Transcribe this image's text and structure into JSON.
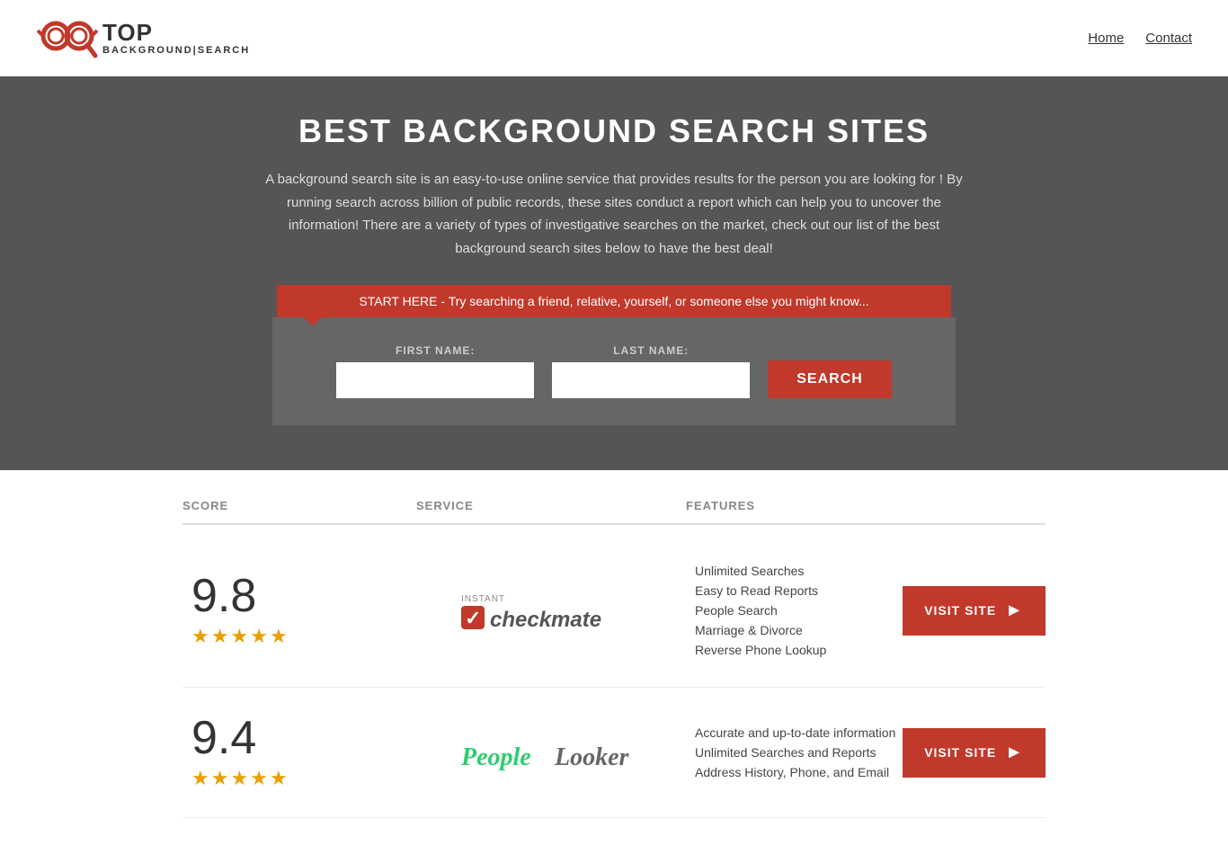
{
  "header": {
    "logo_top": "TOP",
    "logo_sub_line1": "BACKGROUND",
    "logo_sub_line2": "SEARCH",
    "nav": [
      {
        "label": "Home",
        "href": "#"
      },
      {
        "label": "Contact",
        "href": "#"
      }
    ]
  },
  "hero": {
    "title": "BEST BACKGROUND SEARCH SITES",
    "description": "A background search site is an easy-to-use online service that provides results  for the person you are looking for ! By  running  search across billion of public records, these sites conduct  a report which can help you to uncover the information! There are a variety of types of investigative searches on the market, check out our  list of the best background search sites below to have the best deal!",
    "callout": "START HERE - Try searching a friend, relative, yourself, or someone else you might know...",
    "form": {
      "first_name_label": "FIRST NAME:",
      "last_name_label": "LAST NAME:",
      "first_name_placeholder": "",
      "last_name_placeholder": "",
      "search_button": "SEARCH"
    }
  },
  "table": {
    "headers": {
      "score": "SCORE",
      "service": "SERVICE",
      "features": "FEATURES"
    },
    "rows": [
      {
        "score": "9.8",
        "stars": 4.5,
        "service_name": "Instant Checkmate",
        "service_type": "checkmate",
        "features": [
          "Unlimited Searches",
          "Easy to Read Reports",
          "People Search",
          "Marriage & Divorce",
          "Reverse Phone Lookup"
        ],
        "visit_label": "VISIT SITE"
      },
      {
        "score": "9.4",
        "stars": 4.5,
        "service_name": "PeopleLooker",
        "service_type": "peoplelooker",
        "features": [
          "Accurate and up-to-date information",
          "Unlimited Searches and Reports",
          "Address History, Phone, and Email"
        ],
        "visit_label": "VISIT SITE"
      }
    ]
  }
}
